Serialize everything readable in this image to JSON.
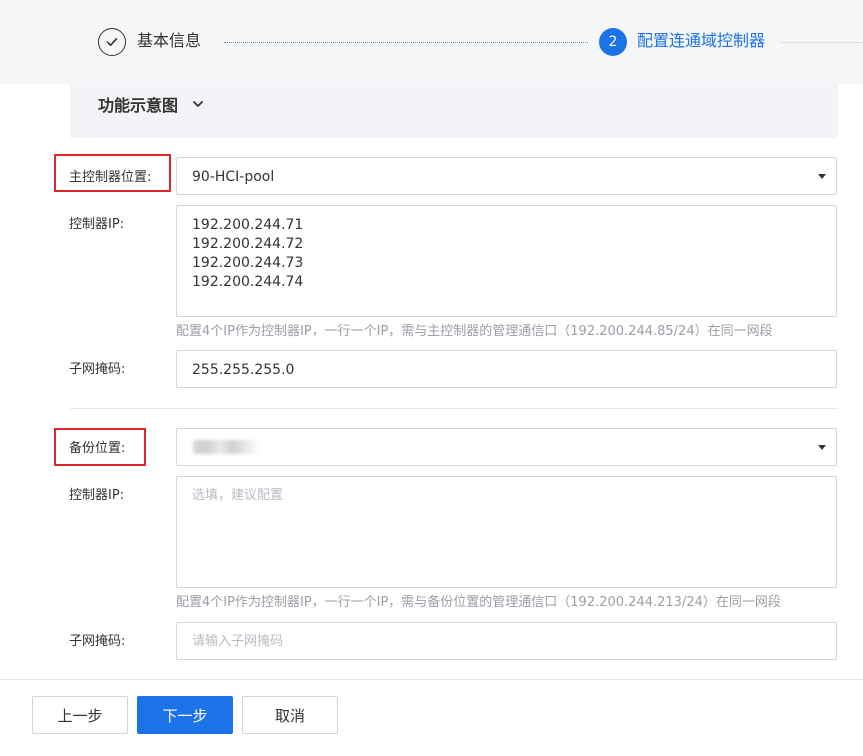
{
  "stepper": {
    "steps": [
      {
        "label": "基本信息",
        "status": "done"
      },
      {
        "number": "2",
        "label": "配置连通域控制器",
        "status": "active"
      }
    ]
  },
  "diagram": {
    "title": "功能示意图"
  },
  "primary": {
    "location_label": "主控制器位置:",
    "location_value": "90-HCI-pool",
    "controller_ip_label": "控制器IP:",
    "controller_ips": [
      "192.200.244.71",
      "192.200.244.72",
      "192.200.244.73",
      "192.200.244.74"
    ],
    "hint": "配置4个IP作为控制器IP，一行一个IP，需与主控制器的管理通信口（192.200.244.85/24）在同一网段",
    "subnet_label": "子网掩码:",
    "subnet_value": "255.255.255.0"
  },
  "backup": {
    "location_label": "备份位置:",
    "controller_ip_label": "控制器IP:",
    "controller_ip_placeholder": "选填，建议配置",
    "hint": "配置4个IP作为控制器IP，一行一个IP，需与备份位置的管理通信口（192.200.244.213/24）在同一网段",
    "subnet_label": "子网掩码:",
    "subnet_placeholder": "请输入子网掩码"
  },
  "footer": {
    "prev_label": "上一步",
    "next_label": "下一步",
    "cancel_label": "取消"
  },
  "colors": {
    "accent": "#1c73e8",
    "highlight_box": "#e02727",
    "header_bg": "#f5f6f8"
  }
}
